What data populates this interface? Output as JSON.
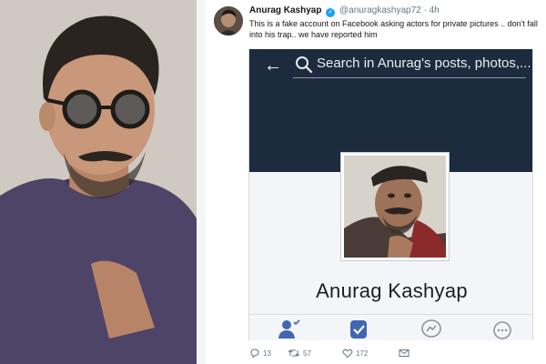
{
  "tweet": {
    "name": "Anurag Kashyap",
    "handle": "@anuragkashyap72",
    "separator": "·",
    "time": "4h",
    "text": "This is a fake account on Facebook asking actors for private pictures .. don't fall into his trap.. we have reported him",
    "verified_glyph": "✓",
    "replies": "13",
    "retweets": "57",
    "likes": "172"
  },
  "fb_screenshot": {
    "back_glyph": "←",
    "search_placeholder": "Search in Anurag's posts, photos,...",
    "profile_name": "Anurag Kashyap",
    "action_icons": [
      "friend-request-icon",
      "following-check-icon",
      "messenger-icon",
      "more-icon"
    ]
  },
  "colors": {
    "twitter_blue": "#1da1f2",
    "facebook_header": "#1d2b3e",
    "facebook_blue": "#4267b2",
    "muted_text": "#657786"
  }
}
